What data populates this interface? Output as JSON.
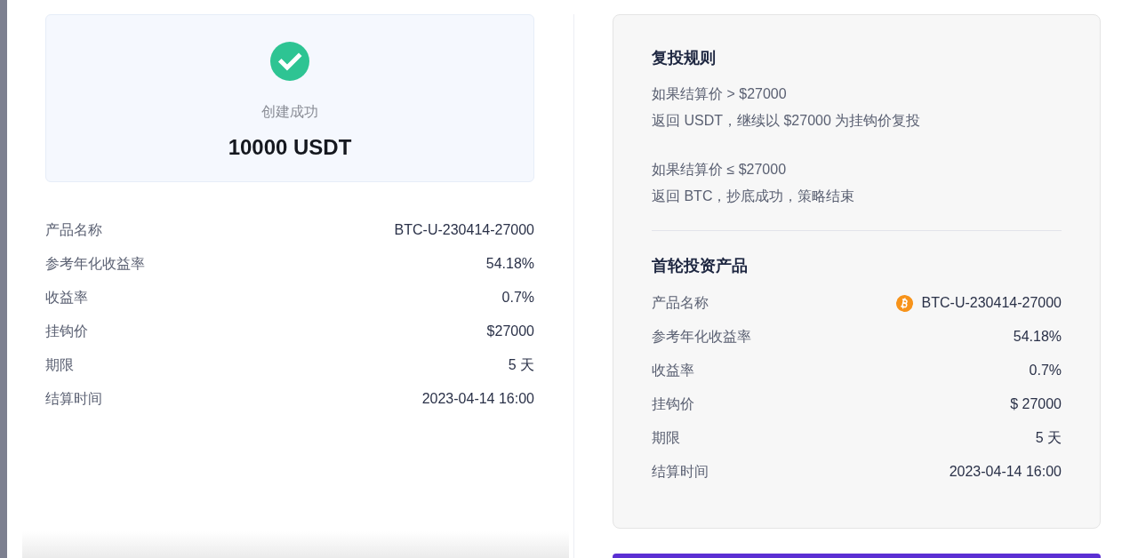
{
  "result": {
    "status": "创建成功",
    "amount": "10000 USDT"
  },
  "details": [
    {
      "label": "产品名称",
      "value": "BTC-U-230414-27000"
    },
    {
      "label": "参考年化收益率",
      "value": "54.18%"
    },
    {
      "label": "收益率",
      "value": "0.7%"
    },
    {
      "label": "挂钩价",
      "value": "$27000"
    },
    {
      "label": "期限",
      "value": "5 天"
    },
    {
      "label": "结算时间",
      "value": "2023-04-14 16:00"
    }
  ],
  "reinvest_rules": {
    "title": "复投规则",
    "rules": [
      {
        "condition": "如果结算价 > $27000",
        "outcome": "返回 USDT，继续以 $27000 为挂钩价复投"
      },
      {
        "condition": "如果结算价 ≤ $27000",
        "outcome": "返回 BTC，抄底成功，策略结束"
      }
    ]
  },
  "first_product": {
    "title": "首轮投资产品",
    "rows": [
      {
        "kind": "coin",
        "label": "产品名称",
        "value": "BTC-U-230414-27000"
      },
      {
        "kind": "text",
        "label": "参考年化收益率",
        "value": "54.18%"
      },
      {
        "kind": "text",
        "label": "收益率",
        "value": "0.7%"
      },
      {
        "kind": "text",
        "label": "挂钩价",
        "value": "$ 27000"
      },
      {
        "kind": "text",
        "label": "期限",
        "value": "5 天"
      },
      {
        "kind": "text",
        "label": "结算时间",
        "value": "2023-04-14 16:00"
      }
    ]
  }
}
